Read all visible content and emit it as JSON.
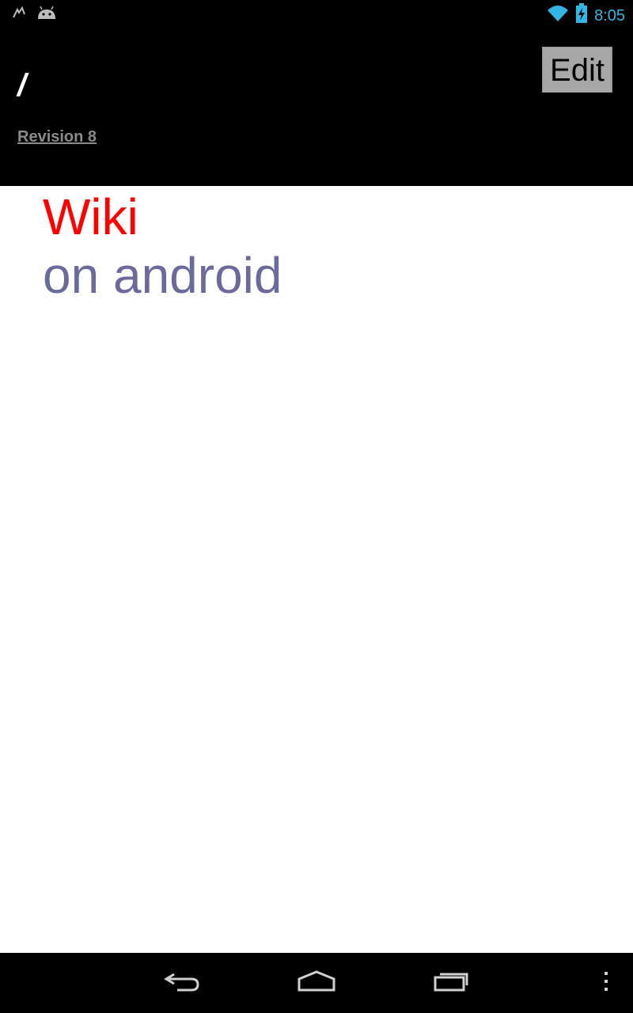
{
  "status_bar": {
    "time": "8:05",
    "time_color": "#33b5e5",
    "left_icons": [
      "notification-icon",
      "android-icon"
    ],
    "right_icons": [
      "wifi-icon",
      "battery-charging-icon"
    ]
  },
  "header": {
    "title": "/",
    "revision_label": "Revision 8",
    "edit_label": "Edit"
  },
  "content": {
    "line1": "Wiki",
    "line1_color": "#ff0000",
    "line2": "on android",
    "line2_color": "#6a6a9c"
  },
  "nav_bar": {
    "buttons": [
      "back-icon",
      "home-icon",
      "recent-apps-icon",
      "menu-icon"
    ]
  }
}
